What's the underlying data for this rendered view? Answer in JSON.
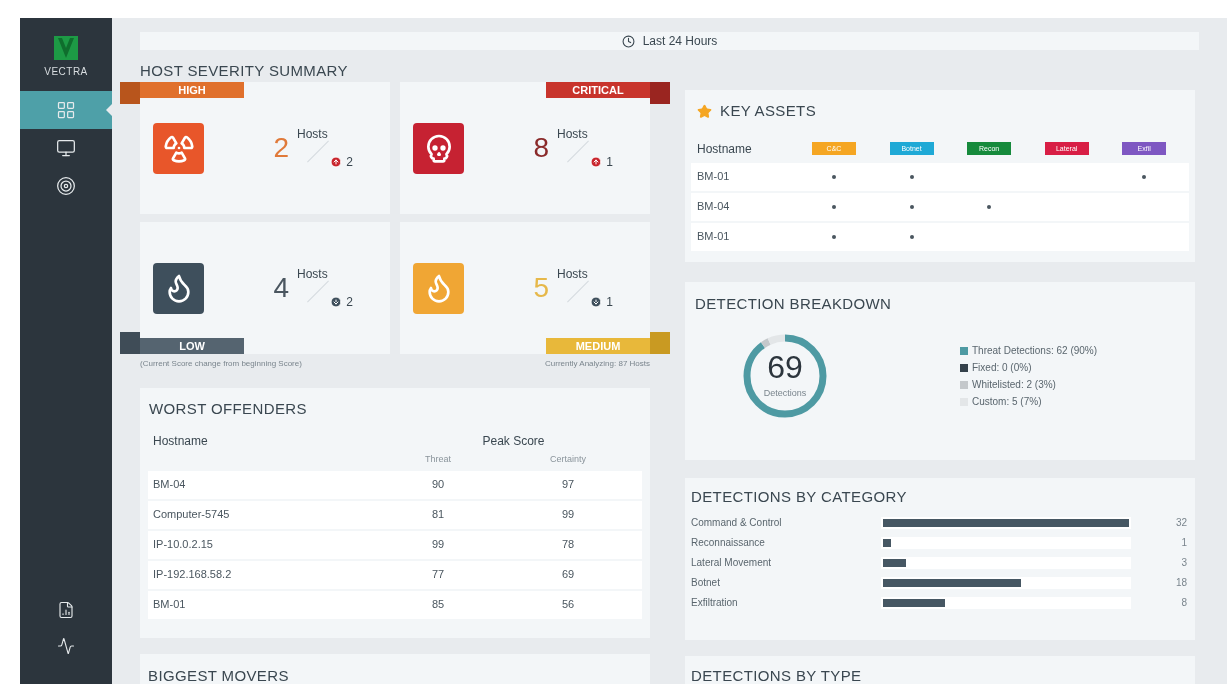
{
  "sidebar": {
    "logo": "VECTRA",
    "items": [
      {
        "kind": "dashboard",
        "selected": true
      },
      {
        "kind": "hosts",
        "selected": false
      },
      {
        "kind": "detections",
        "selected": false
      }
    ],
    "bottom_items": [
      {
        "kind": "reports"
      },
      {
        "kind": "health"
      }
    ]
  },
  "time_range": "Last 24 Hours",
  "severity_summary": {
    "title": "HOST SEVERITY SUMMARY",
    "cards": [
      {
        "kind": "high",
        "label": "HIGH",
        "count": "2",
        "unit": "Hosts",
        "rising": true,
        "change": "2"
      },
      {
        "kind": "critical",
        "label": "CRITICAL",
        "count": "8",
        "unit": "Hosts",
        "rising": true,
        "change": "1"
      },
      {
        "kind": "low",
        "label": "LOW",
        "count": "4",
        "unit": "Hosts",
        "rising": false,
        "change": "2"
      },
      {
        "kind": "medium",
        "label": "MEDIUM",
        "count": "5",
        "unit": "Hosts",
        "rising": false,
        "change": "1"
      }
    ],
    "note": "(Current Score change from beginning Score)",
    "analyzing": "Currently Analyzing: 87 Hosts"
  },
  "worst_offenders": {
    "title": "WORST OFFENDERS",
    "columns": [
      "Hostname",
      "Peak Score"
    ],
    "subcolumns": [
      "Threat",
      "Certainty"
    ],
    "rows": [
      {
        "hostname": "BM-04",
        "threat": "90",
        "certainty": "97"
      },
      {
        "hostname": "Computer-5745",
        "threat": "81",
        "certainty": "99"
      },
      {
        "hostname": "IP-10.0.2.15",
        "threat": "99",
        "certainty": "78"
      },
      {
        "hostname": "IP-192.168.58.2",
        "threat": "77",
        "certainty": "69"
      },
      {
        "hostname": "BM-01",
        "threat": "85",
        "certainty": "56"
      }
    ]
  },
  "biggest_movers": {
    "title": "BIGGEST MOVERS"
  },
  "key_assets": {
    "title": "KEY ASSETS",
    "hostname_header": "Hostname",
    "tags": [
      {
        "label": "C&C",
        "color": "#f5a623"
      },
      {
        "label": "Botnet",
        "color": "#1fa9d6"
      },
      {
        "label": "Recon",
        "color": "#168a3c"
      },
      {
        "label": "Lateral",
        "color": "#d81e45"
      },
      {
        "label": "Exfil",
        "color": "#7e57c2"
      }
    ],
    "rows": [
      {
        "hostname": "BM-01",
        "flags": [
          true,
          true,
          false,
          false,
          true
        ]
      },
      {
        "hostname": "BM-04",
        "flags": [
          true,
          true,
          true,
          false,
          false
        ]
      },
      {
        "hostname": "BM-01",
        "flags": [
          true,
          true,
          false,
          false,
          false
        ]
      }
    ]
  },
  "detection_breakdown": {
    "title": "DETECTION BREAKDOWN",
    "total": "69",
    "total_label": "Detections",
    "legend": [
      {
        "label": "Threat Detections: 62 (90%)",
        "color": "#4e9aa3"
      },
      {
        "label": "Fixed: 0 (0%)",
        "color": "#34414b"
      },
      {
        "label": "Whitelisted: 2 (3%)",
        "color": "#c4c8cb"
      },
      {
        "label": "Custom: 5 (7%)",
        "color": "#e3e6e8"
      }
    ]
  },
  "detections_by_category": {
    "title": "DETECTIONS BY CATEGORY",
    "rows": [
      {
        "label": "Command & Control",
        "level": 1,
        "count": "32"
      },
      {
        "label": "Reconnaissance",
        "level": 0.031,
        "count": "1"
      },
      {
        "label": "Lateral Movement",
        "level": 0.094,
        "count": "3"
      },
      {
        "label": "Botnet",
        "level": 0.5625,
        "count": "18"
      },
      {
        "label": "Exfiltration",
        "level": 0.25,
        "count": "8"
      }
    ]
  },
  "detections_by_type": {
    "title": "DETECTIONS BY TYPE"
  }
}
